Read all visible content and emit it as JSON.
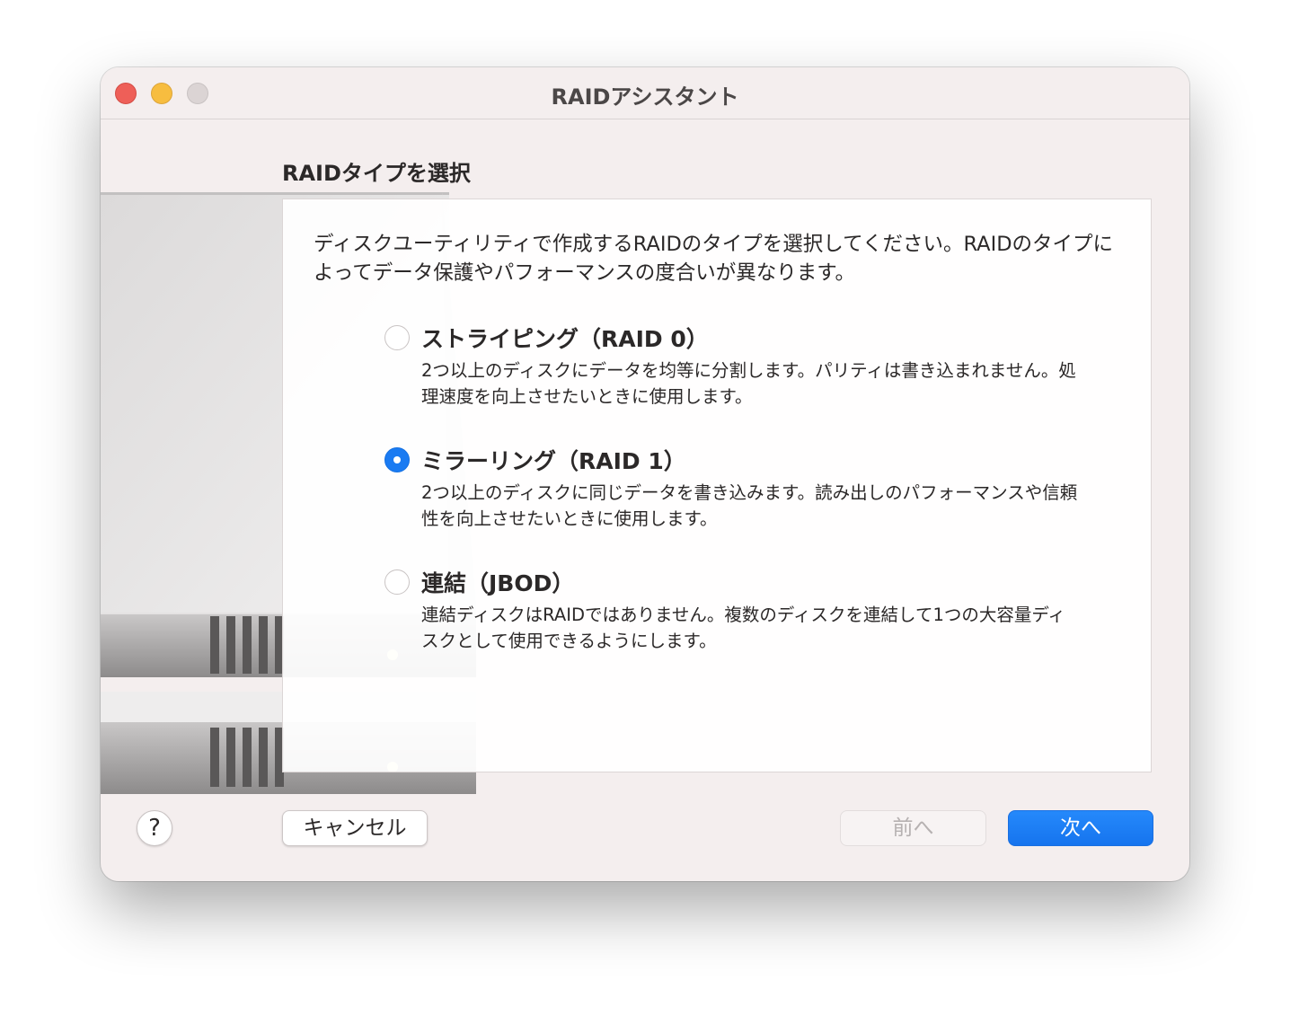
{
  "window": {
    "title": "RAIDアシスタント"
  },
  "section": {
    "heading": "RAIDタイプを選択",
    "description": "ディスクユーティリティで作成するRAIDのタイプを選択してください。RAIDのタイプによってデータ保護やパフォーマンスの度合いが異なります。"
  },
  "options": [
    {
      "title": "ストライピング（RAID 0）",
      "description": "2つ以上のディスクにデータを均等に分割します。パリティは書き込まれません。処理速度を向上させたいときに使用します。",
      "selected": false
    },
    {
      "title": "ミラーリング（RAID 1）",
      "description": "2つ以上のディスクに同じデータを書き込みます。読み出しのパフォーマンスや信頼性を向上させたいときに使用します。",
      "selected": true
    },
    {
      "title": "連結（JBOD）",
      "description": "連結ディスクはRAIDではありません。複数のディスクを連結して1つの大容量ディスクとして使用できるようにします。",
      "selected": false
    }
  ],
  "buttons": {
    "help": "?",
    "cancel": "キャンセル",
    "back": "前へ",
    "next": "次へ"
  },
  "colors": {
    "accent": "#1a7bf2",
    "window_background": "#f4eeee"
  },
  "icons": {
    "close": "close-icon",
    "minimize": "minimize-icon",
    "zoom": "zoom-icon",
    "illustration": "raid-disk-illustration"
  }
}
